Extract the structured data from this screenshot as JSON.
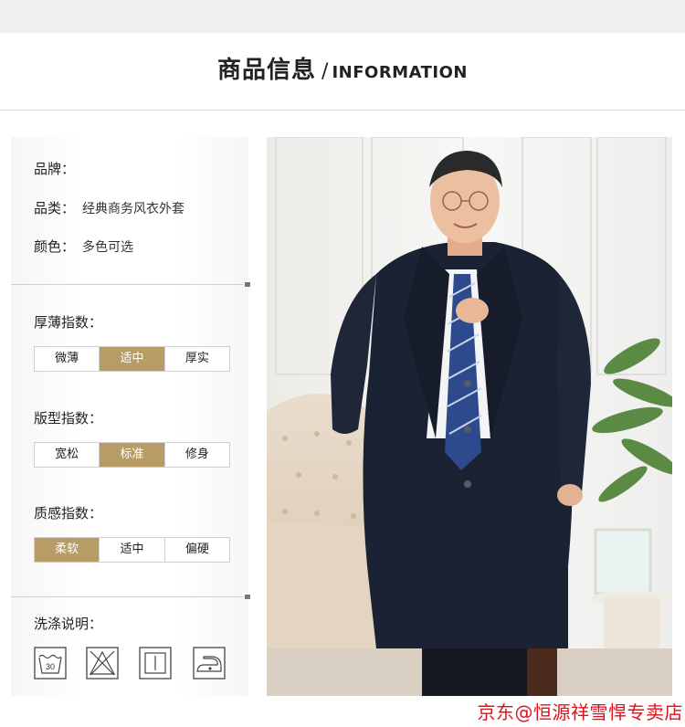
{
  "header": {
    "title_cn": "商品信息",
    "separator": "/",
    "title_en": "INFORMATION"
  },
  "info": [
    {
      "key": "品牌：",
      "value": ""
    },
    {
      "key": "品类：",
      "value": "经典商务风衣外套"
    },
    {
      "key": "颜色：",
      "value": "多色可选"
    }
  ],
  "thickness": {
    "title": "厚薄指数：",
    "options": [
      "微薄",
      "适中",
      "厚实"
    ],
    "selected": "适中"
  },
  "fit": {
    "title": "版型指数：",
    "options": [
      "宽松",
      "标准",
      "修身"
    ],
    "selected": "标准"
  },
  "texture": {
    "title": "质感指数：",
    "options": [
      "柔软",
      "适中",
      "偏硬"
    ],
    "selected": "柔软"
  },
  "care": {
    "title": "洗涤说明：",
    "icons": [
      "wash-30-icon",
      "no-bleach-icon",
      "tumble-dry-icon",
      "iron-icon"
    ],
    "wash_temp": "30"
  },
  "accent_color": "#b89c65",
  "watermark": "京东@恒源祥雪悍专卖店"
}
